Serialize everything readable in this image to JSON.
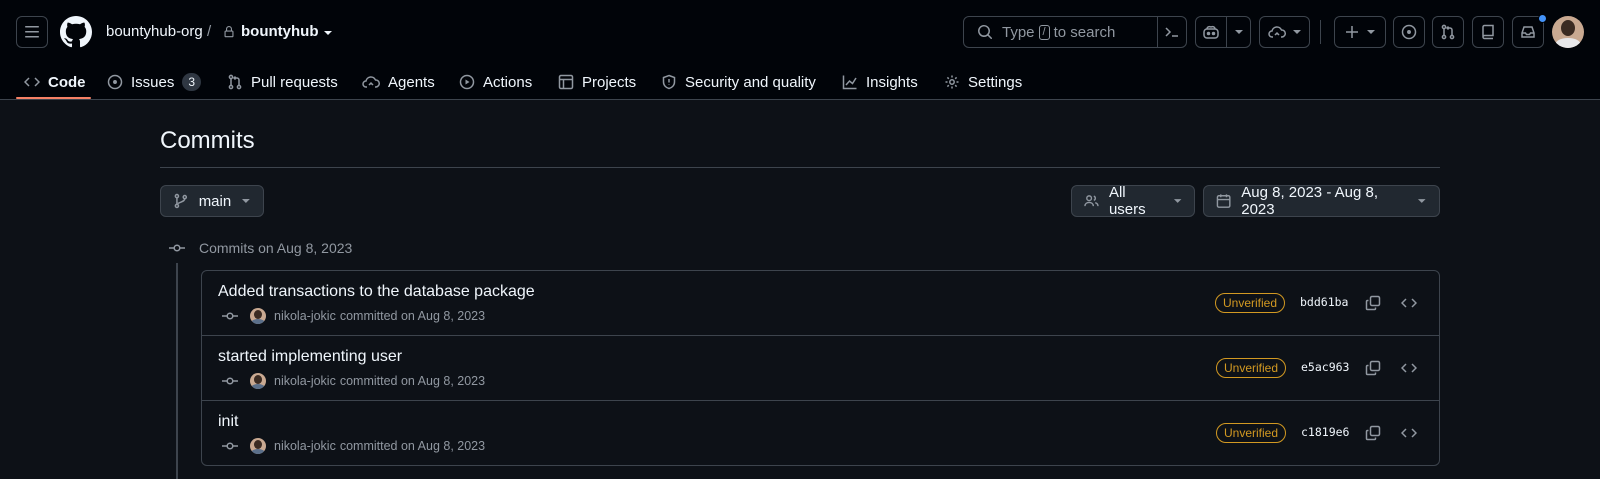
{
  "header": {
    "org": "bountyhub-org",
    "separator": "/",
    "repo": "bountyhub",
    "search": {
      "prefix": "Type",
      "key": "/",
      "suffix": "to search"
    }
  },
  "tabs": [
    {
      "label": "Code",
      "icon": "code-icon",
      "active": true
    },
    {
      "label": "Issues",
      "icon": "issue-opened-icon",
      "count": "3"
    },
    {
      "label": "Pull requests",
      "icon": "git-pull-request-icon"
    },
    {
      "label": "Agents",
      "icon": "agent-cloud-icon"
    },
    {
      "label": "Actions",
      "icon": "play-icon"
    },
    {
      "label": "Projects",
      "icon": "table-icon"
    },
    {
      "label": "Security and quality",
      "icon": "shield-icon"
    },
    {
      "label": "Insights",
      "icon": "graph-icon"
    },
    {
      "label": "Settings",
      "icon": "gear-icon"
    }
  ],
  "page": {
    "title": "Commits",
    "branch": "main",
    "users_filter": "All users",
    "date_range": "Aug 8, 2023 - Aug 8, 2023"
  },
  "group": {
    "heading": "Commits on Aug 8, 2023",
    "commits": [
      {
        "message": "Added transactions to the database package",
        "author": "nikola-jokic",
        "action": "committed on Aug 8, 2023",
        "status": "Unverified",
        "sha": "bdd61ba"
      },
      {
        "message": "started implementing user",
        "author": "nikola-jokic",
        "action": "committed on Aug 8, 2023",
        "status": "Unverified",
        "sha": "e5ac963"
      },
      {
        "message": "init",
        "author": "nikola-jokic",
        "action": "committed on Aug 8, 2023",
        "status": "Unverified",
        "sha": "c1819e6"
      }
    ]
  },
  "colors": {
    "background": "#0d1117",
    "header": "#010409",
    "border": "#3d444d",
    "accent_underline": "#f78166",
    "unverified": "#d29922",
    "notification_dot": "#4493f8"
  }
}
